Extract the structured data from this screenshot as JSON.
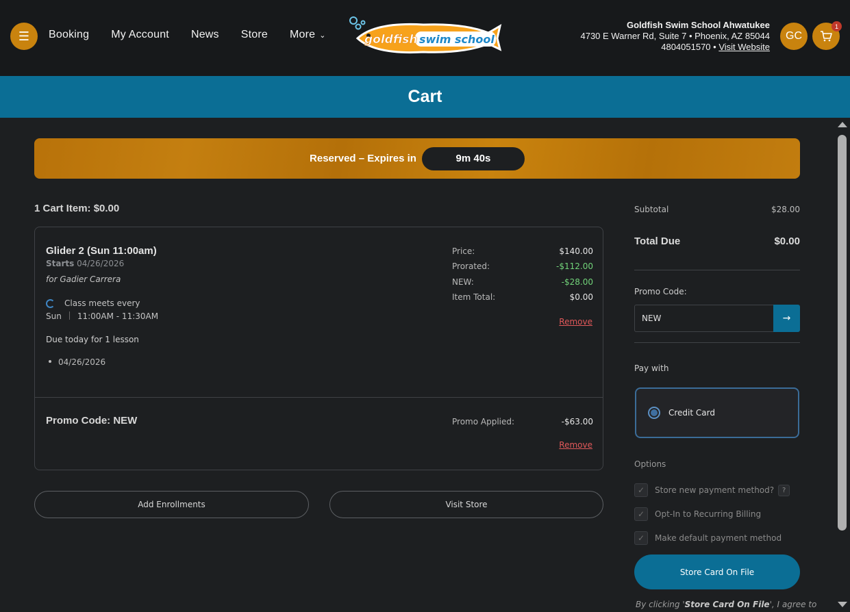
{
  "header": {
    "nav": [
      "Booking",
      "My Account",
      "News",
      "Store",
      "More"
    ],
    "logo_text": "goldfish swim school",
    "school_name": "Goldfish Swim School Ahwatukee",
    "address": "4730 E Warner Rd, Suite 7 • Phoenix, AZ 85044",
    "phone": "4804051570",
    "phone_sep": " • ",
    "website_label": "Visit Website",
    "avatar_initials": "GC",
    "cart_count": "1"
  },
  "page_title": "Cart",
  "reservation": {
    "label": "Reserved – Expires in",
    "timer": "9m 40s"
  },
  "cart_summary": "1 Cart Item: $0.00",
  "item": {
    "title": "Glider 2 (Sun 11:00am)",
    "starts_label": "Starts",
    "starts_date": "04/26/2026",
    "for": "for Gadier Carrera",
    "meets_label": "Class meets every",
    "day": "Sun",
    "time": "11:00AM - 11:30AM",
    "due_text": "Due today for 1 lesson",
    "dates": [
      "04/26/2026"
    ],
    "price_rows": [
      {
        "label": "Price:",
        "value": "$140.00",
        "color": "#e6e6e6"
      },
      {
        "label": "Prorated:",
        "value": "-$112.00",
        "color": "#72d47a"
      },
      {
        "label": "NEW:",
        "value": "-$28.00",
        "color": "#72d47a"
      },
      {
        "label": "Item Total:",
        "value": "$0.00",
        "color": "#e6e6e6"
      }
    ],
    "remove_label": "Remove"
  },
  "promo": {
    "title": "Promo Code: NEW",
    "applied_label": "Promo Applied:",
    "applied_value": "-$63.00",
    "remove_label": "Remove"
  },
  "buttons": {
    "add_enrollments": "Add Enrollments",
    "visit_store": "Visit Store",
    "store_card": "Store Card On File"
  },
  "summary": {
    "subtotal_label": "Subtotal",
    "subtotal_value": "$28.00",
    "total_label": "Total Due",
    "total_value": "$0.00",
    "promo_label": "Promo Code:",
    "promo_value": "NEW",
    "pay_with_label": "Pay with",
    "payment_method": "Credit Card",
    "options_label": "Options",
    "options": [
      "Store new payment method?",
      "Opt-In to Recurring Billing",
      "Make default payment method"
    ],
    "agree_prefix": "By clicking '",
    "agree_bold": "Store Card On File",
    "agree_suffix": "', I agree to"
  },
  "colors": {
    "accent_orange": "#c9830e",
    "brand_blue": "#0b6e95",
    "discount_green": "#72d47a",
    "remove_red": "#e2595a"
  }
}
